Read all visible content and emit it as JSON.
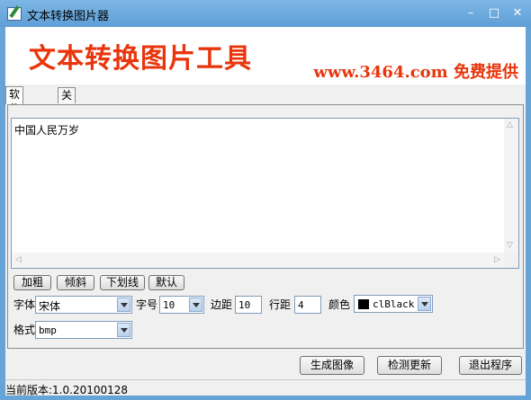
{
  "window": {
    "title": "文本转换图片器"
  },
  "banner": {
    "title": "文本转换图片工具",
    "subtitle": "www.3464.com 免费提供"
  },
  "tabs": [
    {
      "label": "软件设置",
      "active": true
    },
    {
      "label": "关于我们",
      "active": false
    }
  ],
  "editor": {
    "text": "中国人民万岁"
  },
  "format_buttons": {
    "bold": "加粗",
    "italic": "倾斜",
    "underline": "下划线",
    "default": "默认"
  },
  "settings": {
    "font_label": "字体",
    "font_value": "宋体",
    "size_label": "字号",
    "size_value": "10",
    "margin_label": "边距",
    "margin_value": "10",
    "spacing_label": "行距",
    "spacing_value": "4",
    "color_label": "颜色",
    "color_value": "clBlack",
    "color_hex": "#000000",
    "format_label": "格式",
    "format_value": "bmp"
  },
  "actions": {
    "generate": "生成图像",
    "check_update": "检测更新",
    "exit": "退出程序"
  },
  "status": {
    "version": "当前版本:1.0.20100128"
  },
  "colors": {
    "titlebar": "#5f9fd6",
    "banner_text": "#e8350c"
  }
}
